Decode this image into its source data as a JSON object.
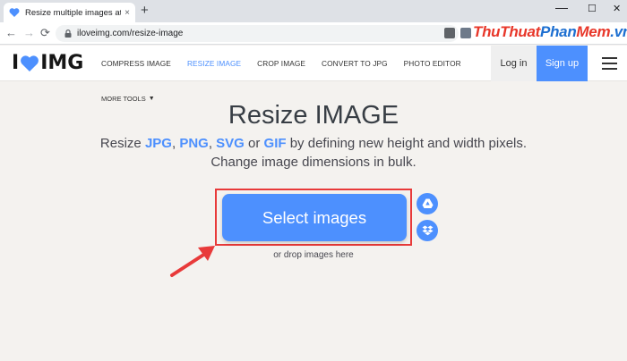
{
  "browser": {
    "tab_title": "Resize multiple images at once!",
    "tab_close": "×",
    "new_tab": "+",
    "min": "—",
    "max": "☐",
    "close": "✕",
    "back": "←",
    "forward": "→",
    "reload": "⟳",
    "url": "iloveimg.com/resize-image",
    "watermark_1": "Thu",
    "watermark_2": "Thuat",
    "watermark_3": "Phan",
    "watermark_4": "Mem",
    "watermark_5": ".vn"
  },
  "header": {
    "logo_left": "I",
    "logo_right": "IMG",
    "nav": [
      "COMPRESS IMAGE",
      "RESIZE IMAGE",
      "CROP IMAGE",
      "CONVERT TO JPG",
      "PHOTO EDITOR"
    ],
    "login": "Log in",
    "signup": "Sign up"
  },
  "main": {
    "more_tools": "MORE TOOLS",
    "title": "Resize IMAGE",
    "sub_1": "Resize ",
    "fmt_1": "JPG",
    "sep_1": ", ",
    "fmt_2": "PNG",
    "sep_2": ", ",
    "fmt_3": "SVG",
    "sep_3": " or ",
    "fmt_4": "GIF",
    "sub_2": " by defining new height and width pixels.",
    "sub_line2": "Change image dimensions in bulk.",
    "select_button": "Select images",
    "drop_text": "or drop images here"
  },
  "colors": {
    "accent": "#4d90fe",
    "highlight": "#e83a3a"
  }
}
